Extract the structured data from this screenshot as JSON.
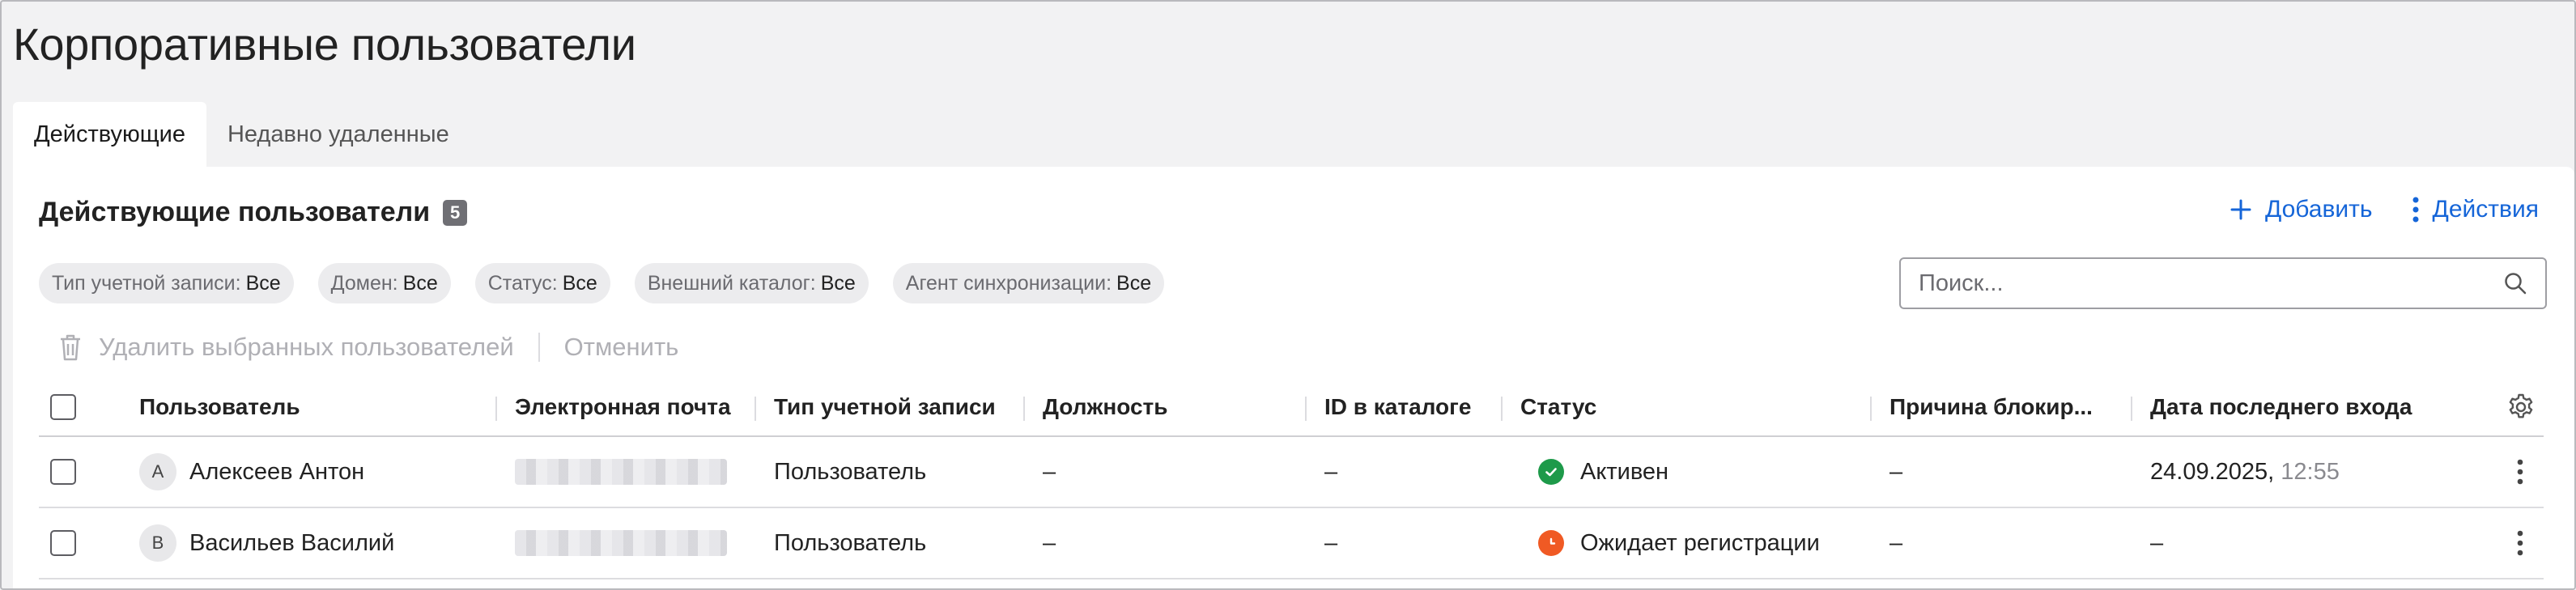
{
  "page_title": "Корпоративные пользователи",
  "tabs": [
    {
      "label": "Действующие",
      "active": true
    },
    {
      "label": "Недавно удаленные",
      "active": false
    }
  ],
  "section": {
    "title": "Действующие пользователи",
    "count": "5"
  },
  "actions": {
    "add_label": "Добавить",
    "actions_label": "Действия"
  },
  "filters": [
    {
      "label": "Тип учетной записи:",
      "value": "Все"
    },
    {
      "label": "Домен:",
      "value": "Все"
    },
    {
      "label": "Статус:",
      "value": "Все"
    },
    {
      "label": "Внешний каталог:",
      "value": "Все"
    },
    {
      "label": "Агент синхронизации:",
      "value": "Все"
    }
  ],
  "search": {
    "placeholder": "Поиск...",
    "value": ""
  },
  "bulk": {
    "delete_label": "Удалить выбранных пользователей",
    "cancel_label": "Отменить"
  },
  "table": {
    "columns": [
      "Пользователь",
      "Электронная почта",
      "Тип учетной записи",
      "Должность",
      "ID в каталоге",
      "Статус",
      "Причина блокир...",
      "Дата последнего входа"
    ],
    "rows": [
      {
        "initial": "А",
        "name": "Алексеев Антон",
        "type": "Пользователь",
        "position": "–",
        "catalog_id": "–",
        "status": "Активен",
        "status_color": "#1e9a4a",
        "block_reason": "–",
        "last_login_date": "24.09.2025,",
        "last_login_time": "12:55"
      },
      {
        "initial": "В",
        "name": "Васильев Василий",
        "type": "Пользователь",
        "position": "–",
        "catalog_id": "–",
        "status": "Ожидает регистрации",
        "status_color": "#f05a24",
        "block_reason": "–",
        "last_login_date": "–",
        "last_login_time": ""
      }
    ]
  },
  "colors": {
    "accent": "#1565d8",
    "active_status": "#1e9a4a",
    "pending_status": "#f05a24"
  }
}
